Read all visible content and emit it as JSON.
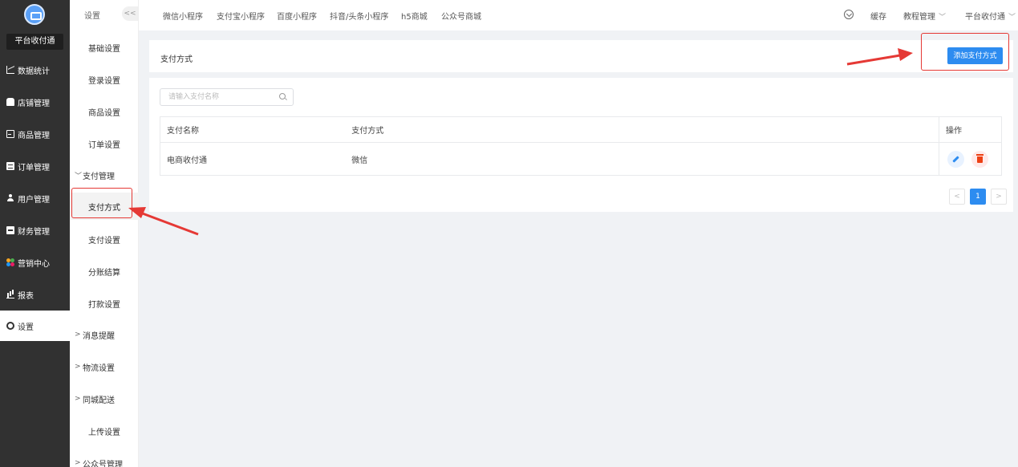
{
  "sidebar": {
    "org_name": "平台收付通",
    "items": [
      {
        "label": "数据统计",
        "icon": "line-chart-icon"
      },
      {
        "label": "店铺管理",
        "icon": "store-icon"
      },
      {
        "label": "商品管理",
        "icon": "goods-icon"
      },
      {
        "label": "订单管理",
        "icon": "order-icon"
      },
      {
        "label": "用户管理",
        "icon": "user-icon"
      },
      {
        "label": "财务管理",
        "icon": "finance-icon"
      },
      {
        "label": "营销中心",
        "icon": "marketing-icon"
      },
      {
        "label": "报表",
        "icon": "report-icon"
      },
      {
        "label": "设置",
        "icon": "gear-icon"
      }
    ]
  },
  "submenu": {
    "title": "设置",
    "collapse": "<<",
    "items": [
      {
        "label": "基础设置"
      },
      {
        "label": "登录设置"
      },
      {
        "label": "商品设置"
      },
      {
        "label": "订单设置"
      },
      {
        "label": "支付管理",
        "chevron": "﹀"
      },
      {
        "label": "支付方式"
      },
      {
        "label": "支付设置"
      },
      {
        "label": "分账结算"
      },
      {
        "label": "打款设置"
      },
      {
        "label": "消息提醒",
        "chevron": ">"
      },
      {
        "label": "物流设置",
        "chevron": ">"
      },
      {
        "label": "同城配送",
        "chevron": ">"
      },
      {
        "label": "上传设置"
      },
      {
        "label": "公众号管理",
        "chevron": ">"
      }
    ]
  },
  "topbar": {
    "tabs": [
      "微信小程序",
      "支付宝小程序",
      "百度小程序",
      "抖音/头条小程序",
      "h5商城",
      "公众号商城"
    ],
    "cache": "缓存",
    "tutorial": "教程管理",
    "account": "平台收付通"
  },
  "page": {
    "title": "支付方式",
    "add_button": "添加支付方式",
    "search_placeholder": "请输入支付名称",
    "table": {
      "headers": [
        "支付名称",
        "支付方式",
        "操作"
      ],
      "rows": [
        {
          "name": "电商收付通",
          "type": "微信"
        }
      ]
    },
    "pager": {
      "prev": "<",
      "current": "1",
      "next": ">"
    }
  },
  "colors": {
    "primary": "#2d8cf0",
    "danger": "#ed4014",
    "sidebar_bg": "#313131",
    "annotation": "#e53935"
  }
}
